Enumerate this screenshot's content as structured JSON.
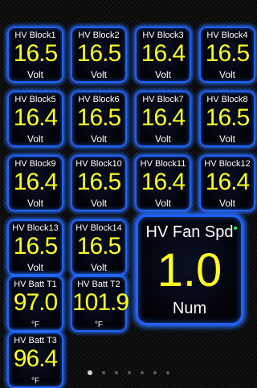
{
  "colors": {
    "value": "#ffff1f",
    "frame": "#1f63ff",
    "label": "#ffffff"
  },
  "gauges": [
    {
      "label": "HV Block1",
      "value": "16.5",
      "unit": "Volt"
    },
    {
      "label": "HV Block2",
      "value": "16.5",
      "unit": "Volt"
    },
    {
      "label": "HV Block3",
      "value": "16.4",
      "unit": "Volt"
    },
    {
      "label": "HV Block4",
      "value": "16.5",
      "unit": "Volt"
    },
    {
      "label": "HV Block5",
      "value": "16.4",
      "unit": "Volt"
    },
    {
      "label": "HV Block6",
      "value": "16.5",
      "unit": "Volt"
    },
    {
      "label": "HV Block7",
      "value": "16.4",
      "unit": "Volt"
    },
    {
      "label": "HV Block8",
      "value": "16.5",
      "unit": "Volt"
    },
    {
      "label": "HV Block9",
      "value": "16.4",
      "unit": "Volt"
    },
    {
      "label": "HV Block10",
      "value": "16.5",
      "unit": "Volt"
    },
    {
      "label": "HV Block11",
      "value": "16.4",
      "unit": "Volt"
    },
    {
      "label": "HV Block12",
      "value": "16.4",
      "unit": "Volt"
    },
    {
      "label": "HV Block13",
      "value": "16.5",
      "unit": "Volt"
    },
    {
      "label": "HV Block14",
      "value": "16.5",
      "unit": "Volt"
    },
    {
      "label": "HV Batt T1",
      "value": "97.0",
      "unit": "°F"
    },
    {
      "label": "HV Batt T2",
      "value": "101.9",
      "unit": "°F"
    },
    {
      "label": "HV Batt T3",
      "value": "96.4",
      "unit": "°F"
    }
  ],
  "big_gauge": {
    "label": "HV Fan Spd",
    "value": "1.0",
    "unit": "Num"
  },
  "pager": {
    "page_count": 7,
    "active_index": 0
  }
}
